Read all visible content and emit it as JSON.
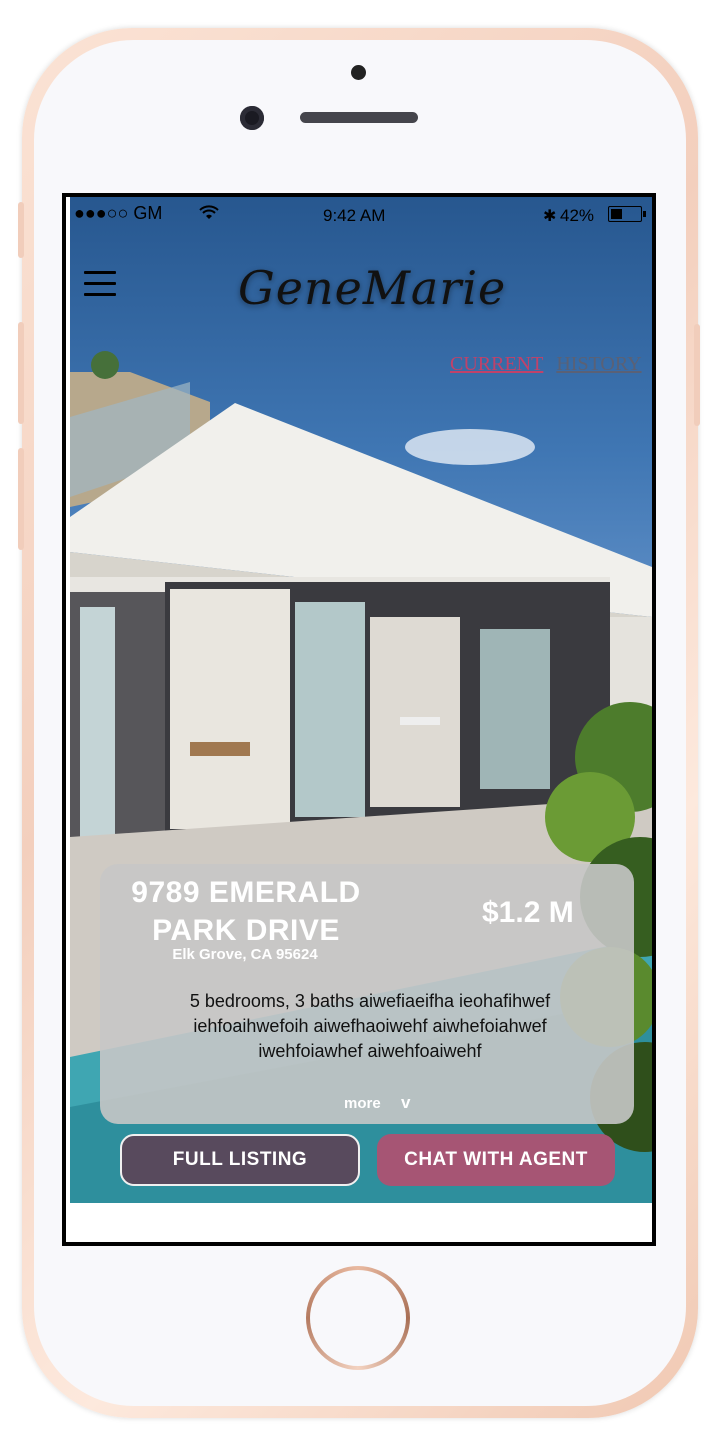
{
  "status_bar": {
    "carrier": "●●●○○ GM",
    "time": "9:42 AM",
    "battery": "42%"
  },
  "header": {
    "app_name": "GeneMarie",
    "tabs": [
      "CURRENT",
      "HISTORY"
    ]
  },
  "listing": {
    "address": "9789 EMERALD PARK DRIVE",
    "city": "Elk Grove, CA 95624",
    "price": "$1.2 M",
    "description": "5 bedrooms, 3 baths aiwefiaeifha ieohafihwef iehfoaihwefoih aiwefhaoiwehf aiwhefoiahwef iwehfoiawhef aiwehfoaiwehf",
    "more_label": "more",
    "more_icon": "v"
  },
  "actions": {
    "full_listing": "FULL LISTING",
    "chat_agent": "CHAT WITH AGENT"
  },
  "icons": [
    "wifi-icon",
    "bluetooth-icon",
    "battery-icon",
    "hamburger-menu-icon",
    "chevron-down-icon"
  ],
  "colors": {
    "accent": "#a65574",
    "tab_active": "#c0426a",
    "tab_inactive": "#5a6176",
    "button_dark": "#5f3e52"
  }
}
